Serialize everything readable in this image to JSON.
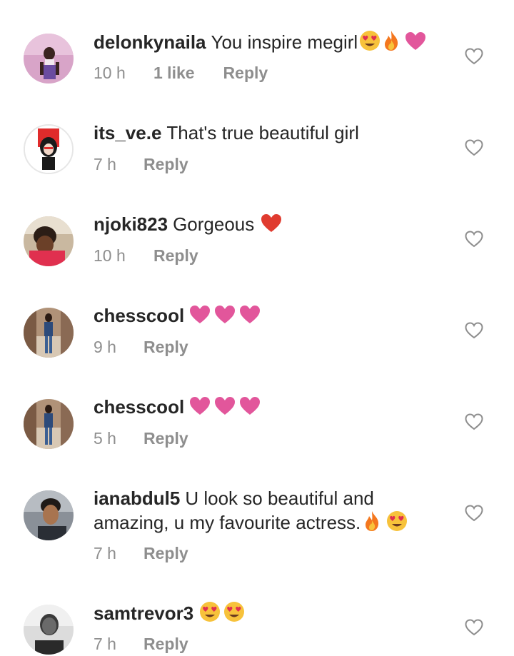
{
  "comments": [
    {
      "username": "delonkynaila",
      "text": "You inspire megirl",
      "emojis": [
        "heart-eyes",
        "fire",
        "pink-heart"
      ],
      "time": "10 h",
      "likes": "1 like",
      "reply": "Reply"
    },
    {
      "username": "its_ve.e",
      "text": "That's true beautiful girl",
      "emojis": [],
      "time": "7 h",
      "reply": "Reply"
    },
    {
      "username": "njoki823",
      "text": "Gorgeous",
      "emojis": [
        "red-heart"
      ],
      "time": "10 h",
      "reply": "Reply"
    },
    {
      "username": "chesscool",
      "text": "",
      "emojis": [
        "pink-heart",
        "pink-heart",
        "pink-heart"
      ],
      "time": "9 h",
      "reply": "Reply"
    },
    {
      "username": "chesscool",
      "text": "",
      "emojis": [
        "pink-heart",
        "pink-heart",
        "pink-heart"
      ],
      "time": "5 h",
      "reply": "Reply"
    },
    {
      "username": "ianabdul5",
      "text": "U look so beautiful and",
      "text_line2": "amazing, u my favourite actress.",
      "emojis": [
        "fire",
        "heart-eyes"
      ],
      "time": "7 h",
      "reply": "Reply"
    },
    {
      "username": "samtrevor3",
      "text": "",
      "emojis": [
        "heart-eyes",
        "heart-eyes"
      ],
      "time": "7 h",
      "reply": "Reply"
    }
  ],
  "colors": {
    "text": "#262626",
    "meta": "#8e8e8e",
    "pink_heart": "#e2569b",
    "red_heart": "#e03b2f"
  }
}
